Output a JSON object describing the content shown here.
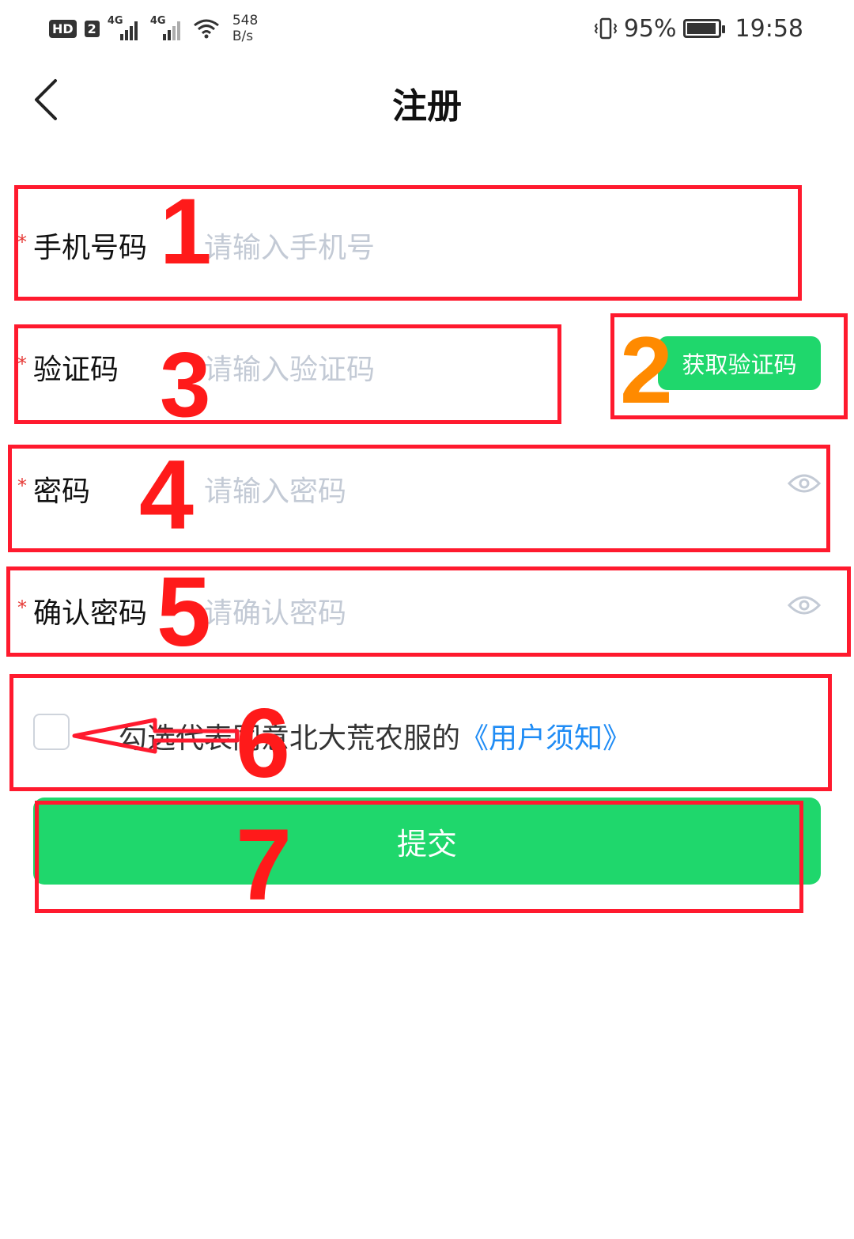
{
  "status_bar": {
    "hd": "HD",
    "sim": "2",
    "net1": "4G",
    "net2": "4G",
    "speed_value": "548",
    "speed_unit": "B/s",
    "battery": "95%",
    "battery_level": 0.95,
    "time": "19:58"
  },
  "header": {
    "title": "注册"
  },
  "form": {
    "required_mark": "*",
    "phone": {
      "label": "手机号码",
      "placeholder": "请输入手机号"
    },
    "code": {
      "label": "验证码",
      "placeholder": "请输入验证码",
      "button": "获取验证码"
    },
    "password": {
      "label": "密码",
      "placeholder": "请输入密码"
    },
    "confirm": {
      "label": "确认密码",
      "placeholder": "请确认密码"
    },
    "agreement": {
      "text": "勾选代表同意北大荒农服的",
      "link": "《用户须知》",
      "checked": false
    },
    "submit": "提交"
  },
  "annotations": [
    "1",
    "2",
    "3",
    "4",
    "5",
    "6",
    "7"
  ],
  "colors": {
    "accent": "#1fd76c",
    "annotation": "#ff1a2e",
    "annotation_2": "#ff8a00",
    "link": "#1f8cf5",
    "required": "#e53935"
  }
}
